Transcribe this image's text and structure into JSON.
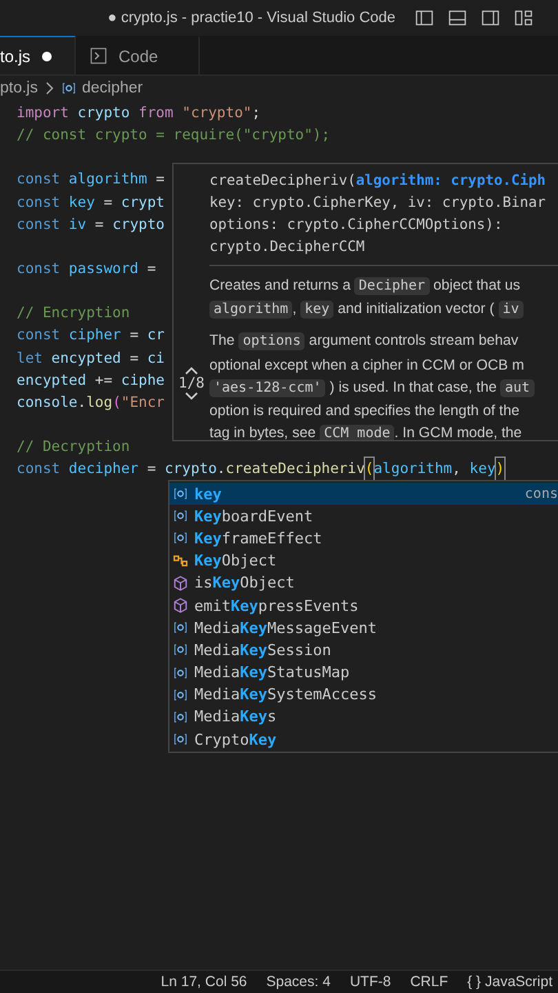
{
  "window": {
    "modified_mark": "●",
    "title": "crypto.js - practie10 - Visual Studio Code"
  },
  "tabs": [
    {
      "label": "to.js",
      "selected": true,
      "modified": true,
      "kind": "file"
    },
    {
      "label": "Code",
      "selected": false,
      "modified": false,
      "kind": "terminal"
    }
  ],
  "breadcrumb": {
    "file": "pto.js",
    "symbol": "decipher"
  },
  "code_blocks": [
    [
      {
        "tokens": [
          {
            "text": "import",
            "kind": "import"
          },
          {
            "text": " crypto ",
            "kind": "var"
          },
          {
            "text": "from",
            "kind": "import"
          },
          {
            "text": " \"crypto\"",
            "kind": "str"
          },
          {
            "text": ";",
            "kind": "punct"
          }
        ]
      },
      {
        "tokens": [
          {
            "text": "// const crypto = require(\"crypto\");",
            "kind": "cmt"
          }
        ]
      }
    ],
    [
      {
        "tokens": [
          {
            "text": "const",
            "kind": "kw"
          },
          {
            "text": " algorithm ",
            "kind": "const"
          },
          {
            "text": "=",
            "kind": "punct"
          }
        ]
      },
      {
        "tokens": [
          {
            "text": "const",
            "kind": "kw"
          },
          {
            "text": " key ",
            "kind": "const"
          },
          {
            "text": "= ",
            "kind": "punct"
          },
          {
            "text": "crypt",
            "kind": "var"
          }
        ]
      },
      {
        "tokens": [
          {
            "text": "const",
            "kind": "kw"
          },
          {
            "text": " iv ",
            "kind": "const"
          },
          {
            "text": "= ",
            "kind": "punct"
          },
          {
            "text": "crypto",
            "kind": "var"
          }
        ]
      }
    ],
    [
      {
        "tokens": [
          {
            "text": "const",
            "kind": "kw"
          },
          {
            "text": " password ",
            "kind": "const"
          },
          {
            "text": "=",
            "kind": "punct"
          }
        ]
      }
    ],
    [
      {
        "tokens": [
          {
            "text": "// Encryption",
            "kind": "cmt"
          }
        ]
      },
      {
        "tokens": [
          {
            "text": "const",
            "kind": "kw"
          },
          {
            "text": " cipher ",
            "kind": "const"
          },
          {
            "text": "= ",
            "kind": "punct"
          },
          {
            "text": "cr",
            "kind": "var"
          }
        ]
      },
      {
        "tokens": [
          {
            "text": "let",
            "kind": "kw"
          },
          {
            "text": " encypted ",
            "kind": "var"
          },
          {
            "text": "= ",
            "kind": "punct"
          },
          {
            "text": "ci",
            "kind": "var"
          }
        ]
      },
      {
        "tokens": [
          {
            "text": "encypted",
            "kind": "var"
          },
          {
            "text": " += ",
            "kind": "punct"
          },
          {
            "text": "ciphe",
            "kind": "var"
          }
        ]
      },
      {
        "tokens": [
          {
            "text": "console",
            "kind": "var"
          },
          {
            "text": ".",
            "kind": "punct"
          },
          {
            "text": "log",
            "kind": "fn"
          },
          {
            "text": "(",
            "kind": "paren"
          },
          {
            "text": "\"Encr",
            "kind": "str"
          }
        ]
      }
    ],
    [
      {
        "tokens": [
          {
            "text": "// Decryption",
            "kind": "cmt"
          }
        ]
      },
      {
        "tokens": [
          {
            "text": "const",
            "kind": "kw"
          },
          {
            "text": " decipher ",
            "kind": "const"
          },
          {
            "text": "= ",
            "kind": "punct"
          },
          {
            "text": "crypto",
            "kind": "var"
          },
          {
            "text": ".",
            "kind": "punct"
          },
          {
            "text": "createDecipheriv",
            "kind": "fn"
          },
          {
            "text": "(",
            "kind": "bracket-match"
          },
          {
            "text": "algorithm",
            "kind": "const"
          },
          {
            "text": ", ",
            "kind": "punct"
          },
          {
            "text": "key",
            "kind": "const"
          },
          {
            "text": ")",
            "kind": "bracket-match"
          }
        ]
      }
    ]
  ],
  "hover": {
    "counter": "1/8",
    "signature": [
      [
        {
          "text": "createDecipheriv(",
          "active": false
        },
        {
          "text": "algorithm: crypto.Ciph",
          "active": true
        }
      ],
      [
        {
          "text": "key: crypto.CipherKey, iv: crypto.Binar",
          "active": false
        }
      ],
      [
        {
          "text": "options: crypto.CipherCCMOptions):",
          "active": false
        }
      ],
      [
        {
          "text": "crypto.DecipherCCM",
          "active": false
        }
      ]
    ],
    "paragraphs": [
      [
        [
          {
            "text": "Creates and returns a ",
            "code": false
          },
          {
            "text": "Decipher",
            "code": true
          },
          {
            "text": " object that us",
            "code": false
          }
        ],
        [
          {
            "text": "algorithm",
            "code": true
          },
          {
            "text": ", ",
            "code": false
          },
          {
            "text": "key",
            "code": true
          },
          {
            "text": " and initialization vector ( ",
            "code": false
          },
          {
            "text": "iv",
            "code": true
          }
        ]
      ],
      [
        [
          {
            "text": "The ",
            "code": false
          },
          {
            "text": "options",
            "code": true
          },
          {
            "text": " argument controls stream behav",
            "code": false
          }
        ],
        [
          {
            "text": "optional except when a cipher in CCM or OCB m",
            "code": false
          }
        ],
        [
          {
            "text": "'aes-128-ccm'",
            "code": true
          },
          {
            "text": " ) is used. In that case, the ",
            "code": false
          },
          {
            "text": "aut",
            "code": true
          }
        ],
        [
          {
            "text": "option is required and specifies the length of the",
            "code": false
          }
        ],
        [
          {
            "text": "tag in bytes, see ",
            "code": false
          },
          {
            "text": "CCM mode",
            "code": true
          },
          {
            "text": ". In GCM mode, the",
            "code": false
          }
        ]
      ]
    ]
  },
  "suggestions": [
    {
      "kind": "variable",
      "match": "key",
      "detail": "cons",
      "selected": true
    },
    {
      "kind": "variable",
      "match": "Key",
      "after": "boardEvent",
      "selected": false
    },
    {
      "kind": "variable",
      "match": "Key",
      "after": "frameEffect",
      "selected": false
    },
    {
      "kind": "class",
      "match": "Key",
      "after": "Object",
      "selected": false
    },
    {
      "kind": "method",
      "before": "is",
      "match": "Key",
      "after": "Object",
      "selected": false
    },
    {
      "kind": "method",
      "before": "emit",
      "match": "Key",
      "after": "pressEvents",
      "selected": false
    },
    {
      "kind": "variable",
      "before": "Media",
      "match": "Key",
      "after": "MessageEvent",
      "selected": false
    },
    {
      "kind": "variable",
      "before": "Media",
      "match": "Key",
      "after": "Session",
      "selected": false
    },
    {
      "kind": "variable",
      "before": "Media",
      "match": "Key",
      "after": "StatusMap",
      "selected": false
    },
    {
      "kind": "variable",
      "before": "Media",
      "match": "Key",
      "after": "SystemAccess",
      "selected": false
    },
    {
      "kind": "variable",
      "before": "Media",
      "match": "Key",
      "after": "s",
      "selected": false
    },
    {
      "kind": "variable",
      "before": "Crypto",
      "match": "Key",
      "selected": false
    }
  ],
  "status_bar": [
    "Ln 17, Col 56",
    "Spaces: 4",
    "UTF-8",
    "CRLF",
    "{ } JavaScript"
  ]
}
